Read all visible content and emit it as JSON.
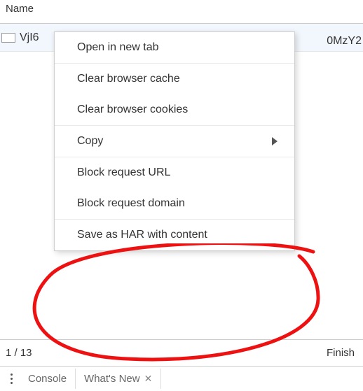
{
  "header": {
    "column_label": "Name"
  },
  "row": {
    "url_left_fragment": "VjI6",
    "url_right_fragment": "0MzY2"
  },
  "context_menu": {
    "open_new_tab": "Open in new tab",
    "clear_cache": "Clear browser cache",
    "clear_cookies": "Clear browser cookies",
    "copy": "Copy",
    "block_url": "Block request URL",
    "block_domain": "Block request domain",
    "save_har": "Save as HAR with content"
  },
  "status": {
    "left_fragment": "1 / 13",
    "right_fragment": "Finish"
  },
  "tabs": {
    "console": "Console",
    "whats_new": "What's New"
  }
}
